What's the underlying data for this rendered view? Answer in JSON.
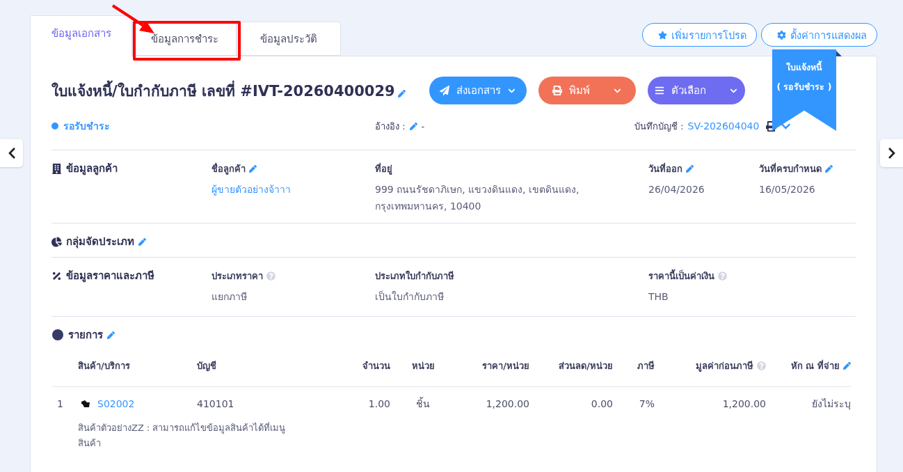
{
  "tabs": [
    {
      "label": "ข้อมูลเอกสาร",
      "selected": true
    },
    {
      "label": "ข้อมูลการชำระ",
      "selected": false
    },
    {
      "label": "ข้อมูลประวัติ",
      "selected": false
    }
  ],
  "top_actions": [
    {
      "kind": "favorite",
      "label": "เพิ่มรายการโปรด"
    },
    {
      "kind": "settings",
      "label": "ตั้งค่าการแสดงผล"
    }
  ],
  "ribbon": {
    "lines": [
      "ใบแจ้งหนี้",
      "( รอรับชำระ )"
    ]
  },
  "document": {
    "title": "ใบแจ้งหนี้/ใบกำกับภาษี เลขที่ #IVT-20260400029",
    "editable": true,
    "status": "รอรับชำระ",
    "reference": {
      "label": "อ้างอิง :",
      "value": "-",
      "editable": true
    },
    "journal": {
      "label": "บันทึกบัญชี :",
      "value": "SV-202604040"
    }
  },
  "action_buttons": [
    {
      "kind": "send",
      "label": "ส่งเอกสาร"
    },
    {
      "kind": "print",
      "label": "พิมพ์"
    },
    {
      "kind": "options",
      "label": "ตัวเลือก"
    }
  ],
  "sections": [
    {
      "kind": "customer",
      "title": "ข้อมูลลูกค้า",
      "editable": false,
      "fields": [
        {
          "label": "ชื่อลูกค้า",
          "editable": true,
          "help": false,
          "value": "ผู้ขายตัวอย่างจ้าาา",
          "link": true
        },
        {
          "label": "ที่อยู่",
          "editable": false,
          "help": false,
          "value": "999 ถนนรัชดาภิเษก, แขวงดินแดง, เขตดินแดง, กรุงเทพมหานคร, 10400",
          "link": false
        },
        {
          "label": "วันที่ออก",
          "editable": true,
          "help": false,
          "value": "26/04/2026",
          "link": false
        },
        {
          "label": "วันที่ครบกำหนด",
          "editable": true,
          "help": false,
          "value": "16/05/2026",
          "link": false
        }
      ]
    },
    {
      "kind": "category",
      "title": "กลุ่มจัดประเภท",
      "editable": true
    },
    {
      "kind": "pricing",
      "title": "ข้อมูลราคาและภาษี",
      "editable": false,
      "fields": [
        {
          "label": "ประเภทราคา",
          "editable": false,
          "help": true,
          "value": "แยกภาษี",
          "link": false
        },
        {
          "label": "ประเภทใบกำกับภาษี",
          "editable": false,
          "help": false,
          "value": "เป็นใบกำกับภาษี",
          "link": false
        },
        {
          "label": "ราคานี้เป็นค่าเงิน",
          "editable": false,
          "help": true,
          "value": "THB",
          "link": false
        }
      ]
    }
  ],
  "items": {
    "title": "รายการ",
    "editable": true,
    "columns": [
      {},
      {
        "label": "สินค้า/บริการ",
        "help": false,
        "editable": false
      },
      {
        "label": "บัญชี",
        "help": false,
        "editable": false
      },
      {
        "label": "จำนวน",
        "help": false,
        "editable": false
      },
      {
        "label": "หน่วย",
        "help": false,
        "editable": false
      },
      {
        "label": "ราคา/หน่วย",
        "help": false,
        "editable": false
      },
      {
        "label": "ส่วนลด/หน่วย",
        "help": false,
        "editable": false
      },
      {
        "label": "ภาษี",
        "help": false,
        "editable": false
      },
      {
        "label": "มูลค่าก่อนภาษี",
        "help": true,
        "editable": false
      },
      {
        "label": "หัก ณ ที่จ่าย",
        "help": false,
        "editable": true
      }
    ],
    "rows": [
      {
        "cells": [
          "1",
          "S02002",
          "410101",
          "1.00",
          "ชิ้น",
          "1,200.00",
          "0.00",
          "7%",
          "1,200.00",
          "ยังไม่ระบุ"
        ],
        "description": "สินค้าตัวอย่างZZ : สามารถแก้ไขข้อมูลสินค้าได้ที่เมนู สินค้า"
      }
    ]
  }
}
